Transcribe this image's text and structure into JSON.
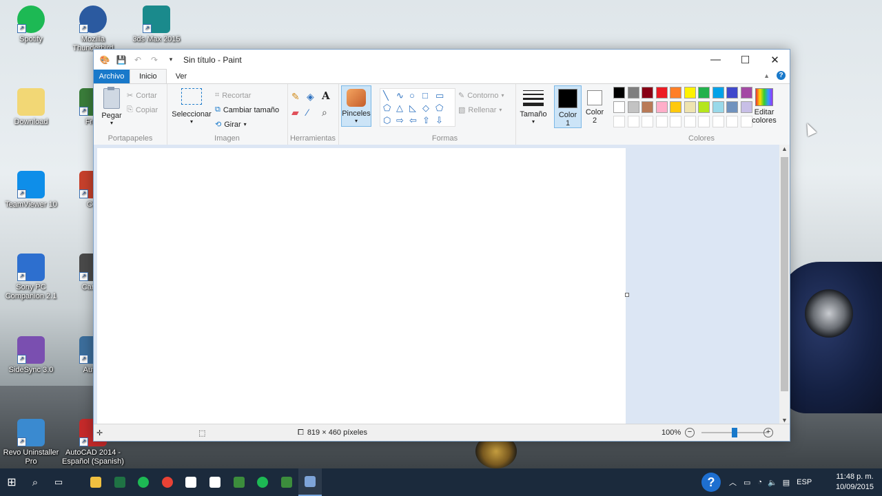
{
  "desktop": {
    "icons": [
      {
        "label": "Spotify",
        "color": "#1db954",
        "icon": "spotify-icon"
      },
      {
        "label": "Mozilla Thunderbird",
        "color": "#2b5aa0",
        "icon": "thunderbird-icon"
      },
      {
        "label": "3ds Max 2015",
        "color": "#1a8a8c",
        "icon": "3dsmax-icon"
      },
      {
        "label": "Download",
        "color": "#f2d775",
        "icon": "folder-icon"
      },
      {
        "label": "Free",
        "color": "#3a7d3a",
        "icon": "app-icon"
      },
      {
        "label": "TeamViewer 10",
        "color": "#0e8ee9",
        "icon": "teamviewer-icon"
      },
      {
        "label": "CCl",
        "color": "#c8412c",
        "icon": "ccleaner-icon"
      },
      {
        "label": "Sony PC Companion 2.1",
        "color": "#2d6fcf",
        "icon": "pc-companion-icon"
      },
      {
        "label": "Camte",
        "color": "#4a4a4a",
        "icon": "camtasia-icon"
      },
      {
        "label": "SideSync 3.0",
        "color": "#7a4fb0",
        "icon": "sidesync-icon"
      },
      {
        "label": "Autod",
        "color": "#3c6e9c",
        "icon": "autodesk-icon"
      },
      {
        "label": "Revo Uninstaller Pro",
        "color": "#3a8ad0",
        "icon": "revo-icon"
      },
      {
        "label": "AutoCAD 2014 - Español (Spanish)",
        "color": "#c62a2a",
        "icon": "autocad-icon"
      }
    ]
  },
  "paint": {
    "title": "Sin título - Paint",
    "tabs": {
      "archivo": "Archivo",
      "inicio": "Inicio",
      "ver": "Ver"
    },
    "help": "?",
    "portapapeles": {
      "pegar": "Pegar",
      "cortar": "Cortar",
      "copiar": "Copiar",
      "label": "Portapapeles"
    },
    "imagen": {
      "seleccionar": "Seleccionar",
      "recortar": "Recortar",
      "cambiar_tamano": "Cambiar tamaño",
      "girar": "Girar",
      "label": "Imagen"
    },
    "herramientas": {
      "label": "Herramientas"
    },
    "pinceles": "Pinceles",
    "formas": {
      "contorno": "Contorno",
      "rellenar": "Rellenar",
      "label": "Formas"
    },
    "tamano": "Tamaño",
    "color1": {
      "label": "Color",
      "num": "1",
      "value": "#000000"
    },
    "color2": {
      "label": "Color",
      "num": "2",
      "value": "#ffffff"
    },
    "colores": {
      "label": "Colores",
      "editar_1": "Editar",
      "editar_2": "colores",
      "row1": [
        "#000000",
        "#7f7f7f",
        "#880015",
        "#ed1c24",
        "#ff7f27",
        "#fff200",
        "#22b14c",
        "#00a2e8",
        "#3f48cc",
        "#a349a4"
      ],
      "row2": [
        "#ffffff",
        "#c3c3c3",
        "#b97a57",
        "#ffaec9",
        "#ffc90e",
        "#efe4b0",
        "#b5e61d",
        "#99d9ea",
        "#7092be",
        "#c8bfe7"
      ],
      "row3": [
        "#ffffff",
        "#ffffff",
        "#ffffff",
        "#ffffff",
        "#ffffff",
        "#ffffff",
        "#ffffff",
        "#ffffff",
        "#ffffff",
        "#ffffff"
      ]
    },
    "status": {
      "dimensions": "819 × 460 píxeles",
      "zoom": "100%",
      "zoom_level": 0.5
    }
  },
  "taskbar": {
    "apps": [
      {
        "name": "file-explorer",
        "color": "#f0c040"
      },
      {
        "name": "excel",
        "color": "#1f7244"
      },
      {
        "name": "spotify",
        "color": "#1db954"
      },
      {
        "name": "chrome",
        "color": "#e94235"
      },
      {
        "name": "mail",
        "color": "#ffffff"
      },
      {
        "name": "calendar",
        "color": "#ffffff"
      },
      {
        "name": "camtasia",
        "color": "#3c8d3c"
      },
      {
        "name": "spotify-2",
        "color": "#1db954"
      },
      {
        "name": "camtasia-2",
        "color": "#3c8d3c"
      },
      {
        "name": "paint",
        "color": "#7ea4d8"
      }
    ],
    "language": "ESP",
    "time": "11:48 p. m.",
    "date": "10/09/2015"
  }
}
